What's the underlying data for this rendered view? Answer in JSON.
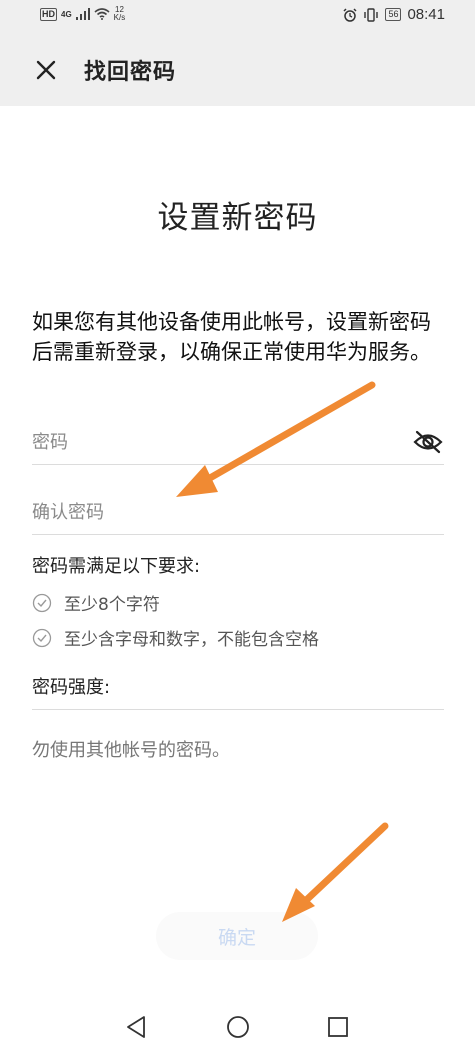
{
  "status_bar": {
    "hd": "HD",
    "network": "4G",
    "speed_value": "12",
    "speed_unit": "K/s",
    "battery": "56",
    "time": "08:41"
  },
  "titlebar": {
    "title": "找回密码"
  },
  "heading": "设置新密码",
  "description": "如果您有其他设备使用此帐号，设置新密码后需重新登录，以确保正常使用华为服务。",
  "password_field": {
    "placeholder": "密码"
  },
  "confirm_field": {
    "placeholder": "确认密码"
  },
  "requirements": {
    "title": "密码需满足以下要求:",
    "items": [
      "至少8个字符",
      "至少含字母和数字，不能包含空格"
    ]
  },
  "strength_label": "密码强度:",
  "tip": "勿使用其他帐号的密码。",
  "confirm_button": "确定",
  "colors": {
    "arrow": "#f08a33",
    "background": "#ffffff",
    "bar": "#efefef",
    "button_text": "#c9d9f2"
  }
}
